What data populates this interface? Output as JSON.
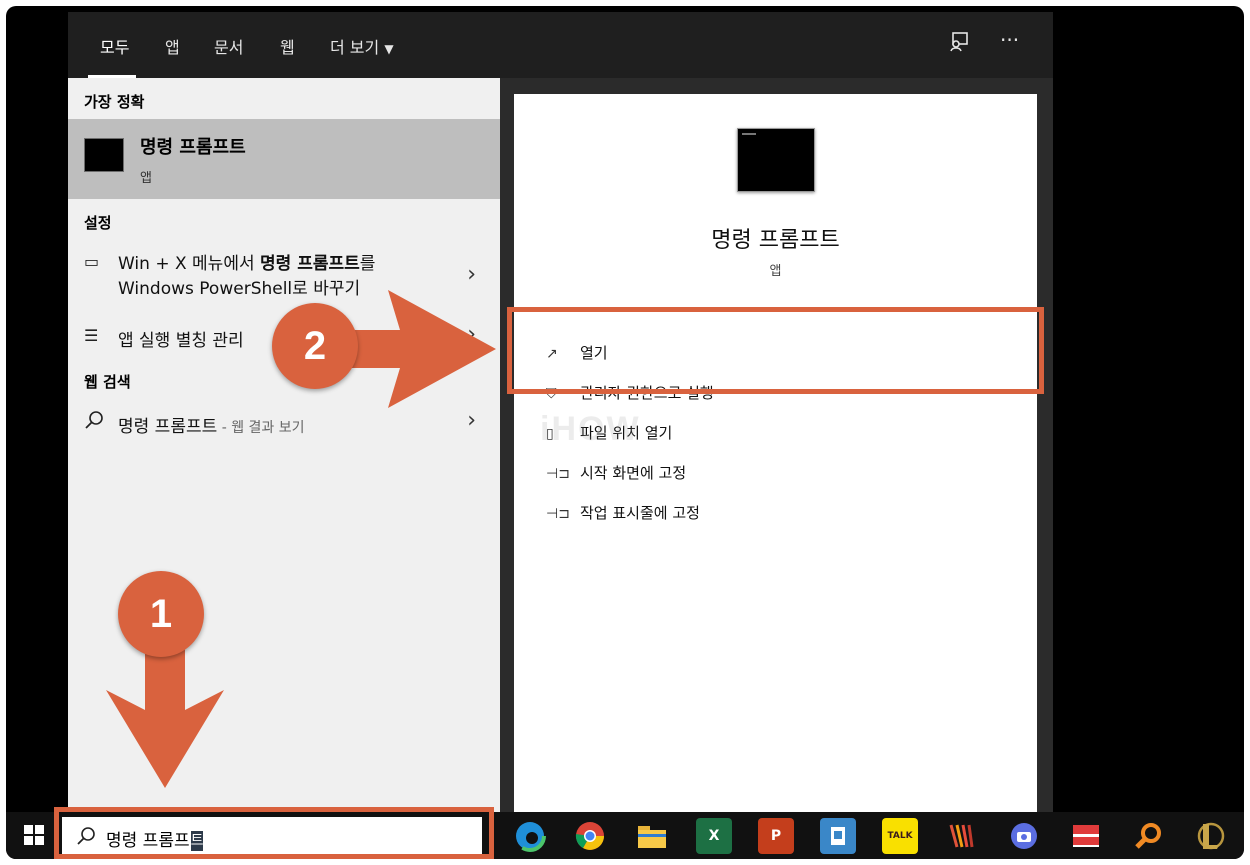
{
  "topbar": {
    "tabs": [
      {
        "label": "모두"
      },
      {
        "label": "앱"
      },
      {
        "label": "문서"
      },
      {
        "label": "웹"
      },
      {
        "label": "더 보기"
      }
    ],
    "more_icon": "ellipsis-icon",
    "feedback_icon": "feedback-icon"
  },
  "left": {
    "best_match_header": "가장 정확",
    "best_match": {
      "title": "명령 프롬프트",
      "subtitle": "앱"
    },
    "settings_header": "설정",
    "settings_items": [
      {
        "line1_pre": "Win + X 메뉴에서 ",
        "line1_bold": "명령 프롬프트",
        "line1_post": "를",
        "line2": "Windows PowerShell로 바꾸기"
      },
      {
        "label": "앱 실행 별칭 관리"
      }
    ],
    "web_header": "웹 검색",
    "web_item": {
      "label": "명령 프롬프트",
      "suffix": " - 웹 결과 보기"
    }
  },
  "right": {
    "title": "명령 프롬프트",
    "subtitle": "앱",
    "actions": [
      {
        "label": "열기",
        "icon": "open-icon"
      },
      {
        "label": "관리자 권한으로 실행",
        "icon": "shield-icon"
      },
      {
        "label": "파일 위치 열기",
        "icon": "file-icon"
      },
      {
        "label": "시작 화면에 고정",
        "icon": "pin-icon"
      },
      {
        "label": "작업 표시줄에 고정",
        "icon": "pin-icon"
      }
    ]
  },
  "taskbar": {
    "search_value": "명령 프롬프",
    "search_caret_char": "트",
    "apps": [
      "edge",
      "chrome",
      "file-explorer",
      "excel",
      "powerpoint",
      "app-blue",
      "kakaotalk",
      "app-stripes",
      "camera",
      "app-red",
      "search-app",
      "league"
    ],
    "excel_label": "X",
    "ppt_label": "P",
    "talk_label": "TALK"
  },
  "annotations": {
    "badge1": "1",
    "badge2": "2"
  },
  "watermark": "iHOW"
}
